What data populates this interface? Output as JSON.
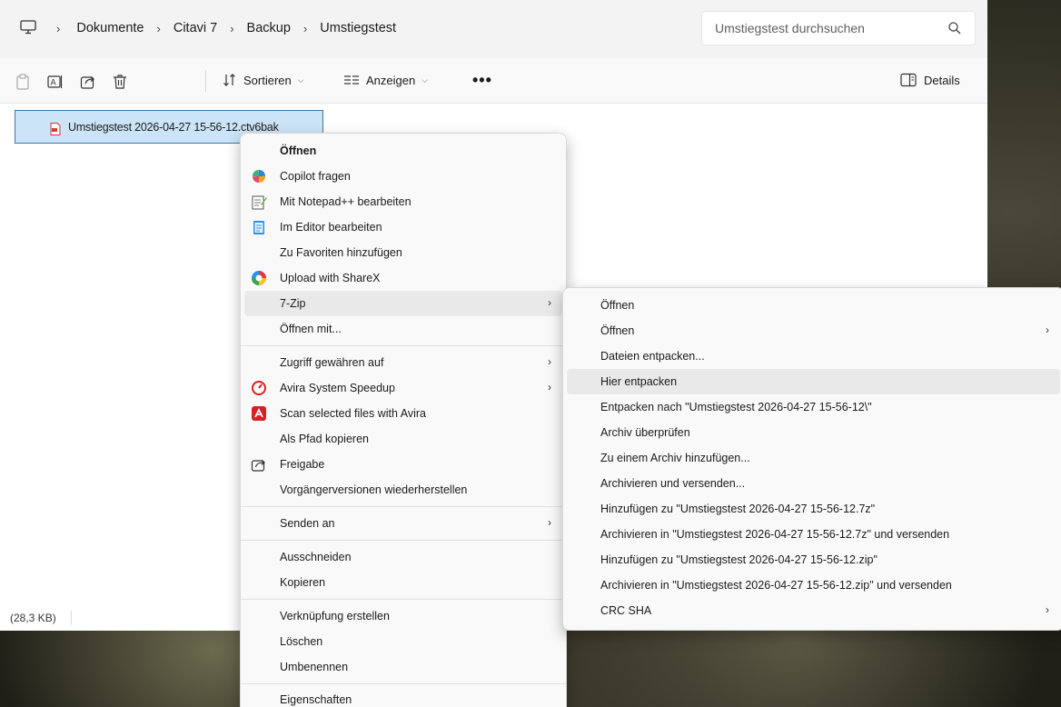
{
  "address": {
    "crumbs": [
      "Dokumente",
      "Citavi 7",
      "Backup",
      "Umstiegstest"
    ],
    "search_placeholder": "Umstiegstest durchsuchen"
  },
  "toolbar": {
    "sort_label": "Sortieren",
    "view_label": "Anzeigen",
    "more_label": "•••",
    "details_label": "Details"
  },
  "file": {
    "name": "Umstiegstest 2026-04-27 15-56-12.ctv6bak"
  },
  "status": {
    "size": "(28,3 KB)"
  },
  "context_menu": {
    "items": [
      {
        "label": "Öffnen"
      },
      {
        "label": "Copilot fragen"
      },
      {
        "label": "Mit Notepad++ bearbeiten"
      },
      {
        "label": "Im Editor bearbeiten"
      },
      {
        "label": "Zu Favoriten hinzufügen"
      },
      {
        "label": "Upload with ShareX"
      },
      {
        "label": "7-Zip"
      },
      {
        "label": "Öffnen mit..."
      },
      {
        "label": "Zugriff gewähren auf"
      },
      {
        "label": "Avira System Speedup"
      },
      {
        "label": "Scan selected files with Avira"
      },
      {
        "label": "Als Pfad kopieren"
      },
      {
        "label": "Freigabe"
      },
      {
        "label": "Vorgängerversionen wiederherstellen"
      },
      {
        "label": "Senden an"
      },
      {
        "label": "Ausschneiden"
      },
      {
        "label": "Kopieren"
      },
      {
        "label": "Verknüpfung erstellen"
      },
      {
        "label": "Löschen"
      },
      {
        "label": "Umbenennen"
      },
      {
        "label": "Eigenschaften"
      }
    ]
  },
  "zip_submenu": {
    "items": [
      {
        "label": "Öffnen"
      },
      {
        "label": "Öffnen"
      },
      {
        "label": "Dateien entpacken..."
      },
      {
        "label": "Hier entpacken"
      },
      {
        "label": "Entpacken nach \"Umstiegstest 2026-04-27 15-56-12\\\""
      },
      {
        "label": "Archiv überprüfen"
      },
      {
        "label": "Zu einem Archiv hinzufügen..."
      },
      {
        "label": "Archivieren und versenden..."
      },
      {
        "label": "Hinzufügen zu \"Umstiegstest 2026-04-27 15-56-12.7z\""
      },
      {
        "label": "Archivieren in \"Umstiegstest 2026-04-27 15-56-12.7z\" und versenden"
      },
      {
        "label": "Hinzufügen zu \"Umstiegstest 2026-04-27 15-56-12.zip\""
      },
      {
        "label": "Archivieren in \"Umstiegstest 2026-04-27 15-56-12.zip\" und versenden"
      },
      {
        "label": "CRC SHA"
      }
    ]
  },
  "colors": {
    "selection_bg": "#cce4f7",
    "selection_border": "#3f77a6",
    "menu_bg": "#f9f9f9",
    "highlight": "#e9e9e9",
    "avira_red": "#d81f26"
  }
}
